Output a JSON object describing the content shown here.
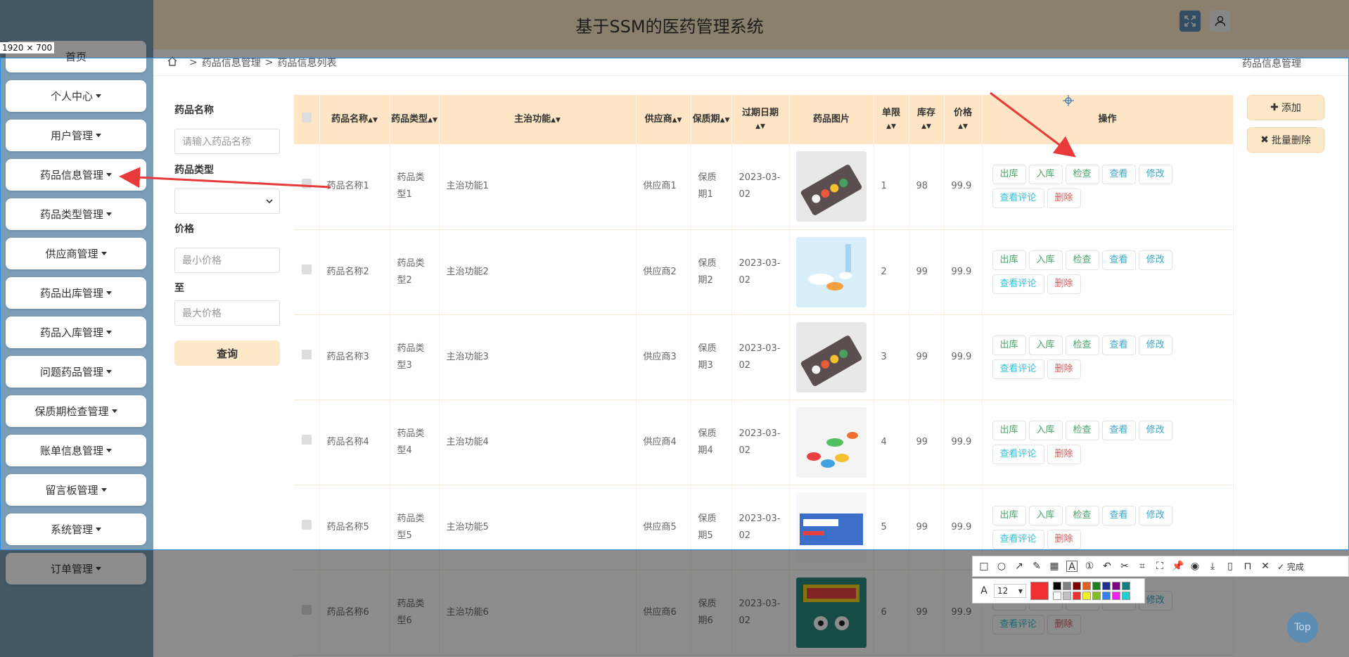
{
  "header": {
    "title": "基于SSM的医药管理系统"
  },
  "sidebar": {
    "items": [
      {
        "label": "首页",
        "has_caret": false
      },
      {
        "label": "个人中心",
        "has_caret": true
      },
      {
        "label": "用户管理",
        "has_caret": true
      },
      {
        "label": "药品信息管理",
        "has_caret": true
      },
      {
        "label": "药品类型管理",
        "has_caret": true
      },
      {
        "label": "供应商管理",
        "has_caret": true
      },
      {
        "label": "药品出库管理",
        "has_caret": true
      },
      {
        "label": "药品入库管理",
        "has_caret": true
      },
      {
        "label": "问题药品管理",
        "has_caret": true
      },
      {
        "label": "保质期检查管理",
        "has_caret": true
      },
      {
        "label": "账单信息管理",
        "has_caret": true
      },
      {
        "label": "留言板管理",
        "has_caret": true
      },
      {
        "label": "系统管理",
        "has_caret": true
      },
      {
        "label": "订单管理",
        "has_caret": true
      }
    ]
  },
  "breadcrumb": {
    "items": [
      "药品信息管理",
      "药品信息列表"
    ],
    "separator": ">",
    "right_label": "药品信息管理"
  },
  "search": {
    "name_label": "药品名称",
    "name_placeholder": "请输入药品名称",
    "type_label": "药品类型",
    "type_value": "",
    "price_label": "价格",
    "min_placeholder": "最小价格",
    "to_label": "至",
    "max_placeholder": "最大价格",
    "submit_label": "查询"
  },
  "actions": {
    "add_label": "添加",
    "batch_delete_label": "批量删除"
  },
  "table": {
    "columns": [
      "药品名称",
      "药品类型",
      "主治功能",
      "供应商",
      "保质期",
      "过期日期",
      "药品图片",
      "单限",
      "库存",
      "价格",
      "操作"
    ],
    "op_labels": {
      "out": "出库",
      "in": "入库",
      "check": "检查",
      "view": "查看",
      "edit": "修改",
      "review": "查看评论",
      "delete": "删除"
    },
    "rows": [
      {
        "name": "药品名称1",
        "type": "药品类型1",
        "function": "主治功能1",
        "supplier": "供应商1",
        "shelf_life": "保质期1",
        "expire": "2023-03-02",
        "limit": "1",
        "stock": "98",
        "price": "99.9"
      },
      {
        "name": "药品名称2",
        "type": "药品类型2",
        "function": "主治功能2",
        "supplier": "供应商2",
        "shelf_life": "保质期2",
        "expire": "2023-03-02",
        "limit": "2",
        "stock": "99",
        "price": "99.9"
      },
      {
        "name": "药品名称3",
        "type": "药品类型3",
        "function": "主治功能3",
        "supplier": "供应商3",
        "shelf_life": "保质期3",
        "expire": "2023-03-02",
        "limit": "3",
        "stock": "99",
        "price": "99.9"
      },
      {
        "name": "药品名称4",
        "type": "药品类型4",
        "function": "主治功能4",
        "supplier": "供应商4",
        "shelf_life": "保质期4",
        "expire": "2023-03-02",
        "limit": "4",
        "stock": "99",
        "price": "99.9"
      },
      {
        "name": "药品名称5",
        "type": "药品类型5",
        "function": "主治功能5",
        "supplier": "供应商5",
        "shelf_life": "保质期5",
        "expire": "2023-03-02",
        "limit": "5",
        "stock": "99",
        "price": "99.9"
      },
      {
        "name": "药品名称6",
        "type": "药品类型6",
        "function": "主治功能6",
        "supplier": "供应商6",
        "shelf_life": "保质期6",
        "expire": "2023-03-02",
        "limit": "6",
        "stock": "99",
        "price": "99.9"
      }
    ]
  },
  "overlay": {
    "size_label": "1920 × 700",
    "done_label": "完成",
    "font_size": "12",
    "current_color": "#f03030",
    "palette": [
      "#000000",
      "#808080",
      "#800000",
      "#e06020",
      "#208020",
      "#203090",
      "#800080",
      "#108080",
      "#ffffff",
      "#c0c0c0",
      "#f03030",
      "#f0f020",
      "#80c020",
      "#3080f0",
      "#f020f0",
      "#20d0d0"
    ],
    "top_label": "Top"
  },
  "colors": {
    "sidebar": "#7b9eb8",
    "header": "#fde8c8",
    "accent": "#5b8db5",
    "table_header": "#fde5c5"
  }
}
